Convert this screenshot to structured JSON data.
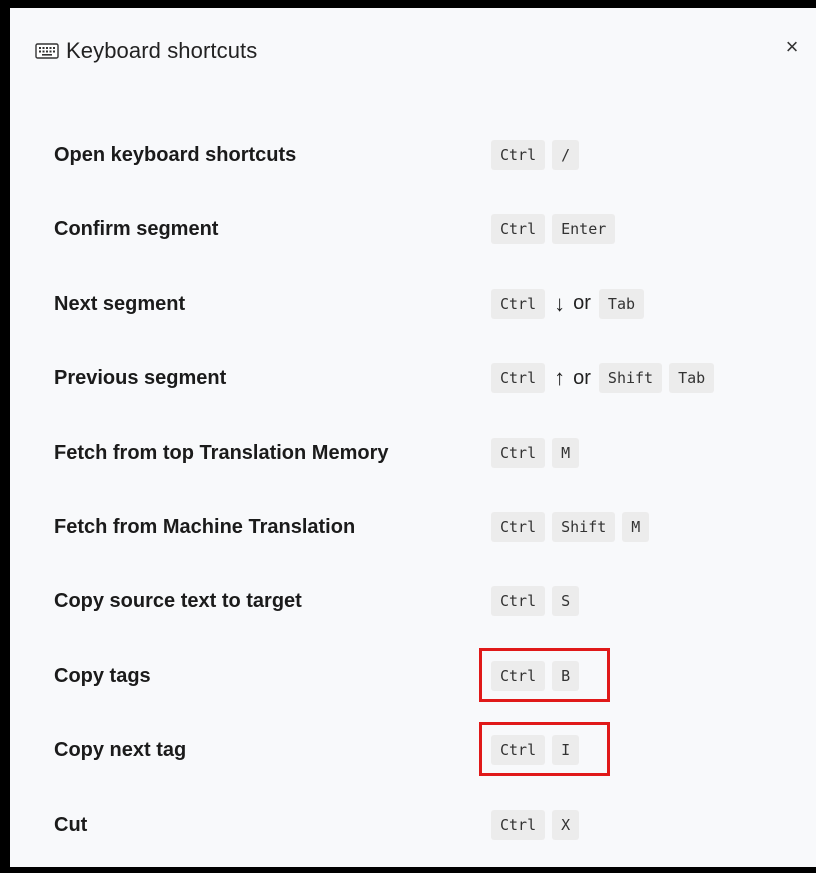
{
  "dialog": {
    "title": "Keyboard shortcuts",
    "close_glyph": "×"
  },
  "shortcuts": [
    {
      "label": "Open keyboard shortcuts",
      "keys": [
        "Ctrl",
        "/"
      ]
    },
    {
      "label": "Confirm segment",
      "keys": [
        "Ctrl",
        "Enter"
      ]
    },
    {
      "label": "Next segment",
      "keys": [
        "Ctrl"
      ],
      "arrow": "↓",
      "or": "or",
      "alt_keys": [
        "Tab"
      ]
    },
    {
      "label": "Previous segment",
      "keys": [
        "Ctrl"
      ],
      "arrow": "↑",
      "or": "or",
      "alt_keys": [
        "Shift",
        "Tab"
      ]
    },
    {
      "label": "Fetch from top Translation Memory",
      "keys": [
        "Ctrl",
        "M"
      ]
    },
    {
      "label": "Fetch from Machine Translation",
      "keys": [
        "Ctrl",
        "Shift",
        "M"
      ]
    },
    {
      "label": "Copy source text to target",
      "keys": [
        "Ctrl",
        "S"
      ]
    },
    {
      "label": "Copy tags",
      "keys": [
        "Ctrl",
        "B"
      ],
      "highlighted": true
    },
    {
      "label": "Copy next tag",
      "keys": [
        "Ctrl",
        "I"
      ],
      "highlighted": true
    },
    {
      "label": "Cut",
      "keys": [
        "Ctrl",
        "X"
      ]
    }
  ],
  "icons": {
    "header": "keyboard-icon",
    "close": "close-icon"
  },
  "colors": {
    "background": "#f8f9fb",
    "key_background": "#ececec",
    "highlight": "#e01919"
  }
}
